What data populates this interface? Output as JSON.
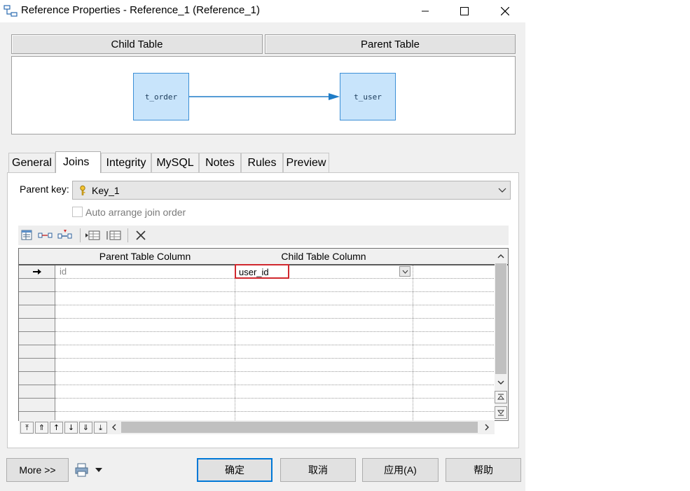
{
  "window": {
    "title": "Reference Properties - Reference_1 (Reference_1)",
    "controls": [
      "minimize",
      "maximize",
      "close"
    ]
  },
  "diagram": {
    "child_header": "Child Table",
    "parent_header": "Parent Table",
    "child_table": "t_order",
    "parent_table": "t_user"
  },
  "tabs": [
    {
      "label": "General"
    },
    {
      "label": "Joins",
      "active": true
    },
    {
      "label": "Integrity"
    },
    {
      "label": "MySQL"
    },
    {
      "label": "Notes"
    },
    {
      "label": "Rules"
    },
    {
      "label": "Preview"
    }
  ],
  "joins": {
    "parent_key_label": "Parent key:",
    "parent_key_value": "Key_1",
    "auto_arrange_label": "Auto arrange join order",
    "auto_arrange_checked": false,
    "toolbar_icons": [
      "properties-icon",
      "add-join-icon",
      "reuse-join-icon",
      "insert-row-icon",
      "add-row-icon",
      "delete-icon"
    ],
    "grid": {
      "columns": [
        "Parent Table Column",
        "Child Table Column"
      ],
      "rows": [
        {
          "parent": "id",
          "child": "user_id",
          "current": true
        }
      ],
      "empty_rows": 11
    }
  },
  "footer": {
    "more_label": "More >>",
    "ok_label": "确定",
    "cancel_label": "取消",
    "apply_label": "应用(A)",
    "help_label": "帮助"
  },
  "colors": {
    "table_fill": "#c8e4fb",
    "table_border": "#3c8fd6",
    "link_line": "#1f7cc7",
    "highlight_border": "#d0282e",
    "default_button_border": "#0078d7"
  }
}
